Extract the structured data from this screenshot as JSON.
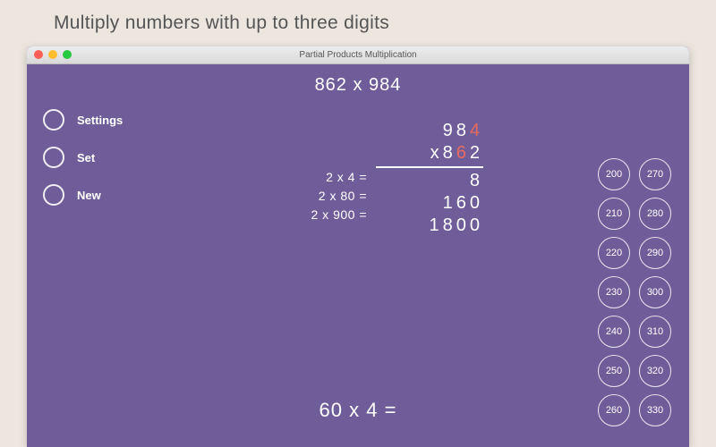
{
  "page_heading": "Multiply numbers with up to three digits",
  "window_title": "Partial Products Multiplication",
  "problem_label": "862 x 984",
  "sidebar": {
    "items": [
      "Settings",
      "Set",
      "New"
    ]
  },
  "vertical": {
    "top_plain": "98",
    "top_hl": "4",
    "bottom_prefix": "x8",
    "bottom_hl": "6",
    "bottom_suffix": "2",
    "results": [
      "8",
      "160",
      "1800"
    ]
  },
  "partial_equations": [
    "2 x 4 =",
    "2 x 80 =",
    "2 x 900 ="
  ],
  "current_question": "60 x 4 =",
  "chips": [
    "200",
    "270",
    "210",
    "280",
    "220",
    "290",
    "230",
    "300",
    "240",
    "310",
    "250",
    "320",
    "260",
    "330"
  ]
}
